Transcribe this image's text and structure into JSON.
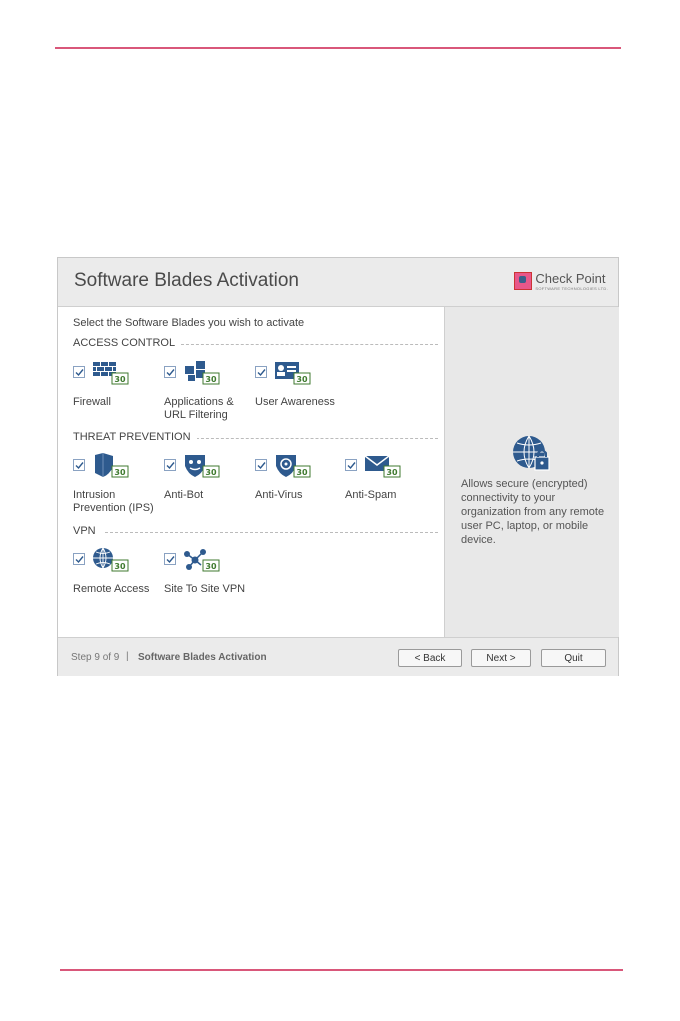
{
  "window": {
    "title": "Software Blades Activation",
    "logo": {
      "name": "Check Point",
      "tagline": "SOFTWARE TECHNOLOGIES LTD."
    }
  },
  "instruction": "Select the Software Blades you wish to activate",
  "sections": {
    "access_control": {
      "label": "ACCESS CONTROL",
      "blades": [
        {
          "label1": "Firewall",
          "label2": "",
          "checked": true,
          "badge": "30",
          "icon": "firewall-icon"
        },
        {
          "label1": "Applications &",
          "label2": "URL Filtering",
          "checked": true,
          "badge": "30",
          "icon": "applications-icon"
        },
        {
          "label1": "User Awareness",
          "label2": "",
          "checked": true,
          "badge": "30",
          "icon": "user-awareness-icon"
        }
      ]
    },
    "threat_prevention": {
      "label": "THREAT PREVENTION",
      "blades": [
        {
          "label1": "Intrusion",
          "label2": "Prevention (IPS)",
          "checked": true,
          "badge": "30",
          "icon": "ips-icon"
        },
        {
          "label1": "Anti-Bot",
          "label2": "",
          "checked": true,
          "badge": "30",
          "icon": "anti-bot-icon"
        },
        {
          "label1": "Anti-Virus",
          "label2": "",
          "checked": true,
          "badge": "30",
          "icon": "anti-virus-icon"
        },
        {
          "label1": "Anti-Spam",
          "label2": "",
          "checked": true,
          "badge": "30",
          "icon": "anti-spam-icon"
        }
      ]
    },
    "vpn": {
      "label": "VPN",
      "blades": [
        {
          "label1": "Remote Access",
          "label2": "",
          "checked": true,
          "badge": "30",
          "icon": "remote-access-icon"
        },
        {
          "label1": "Site To Site VPN",
          "label2": "",
          "checked": true,
          "badge": "30",
          "icon": "site-to-site-vpn-icon"
        }
      ]
    }
  },
  "description": {
    "icon": "remote-access-globe-lock-icon",
    "text": "Allows secure (encrypted) connectivity to your organization from any remote user PC, laptop, or mobile device."
  },
  "footer": {
    "step": "Step 9 of 9",
    "separator": "|",
    "step_name": "Software Blades Activation",
    "back_label": "< Back",
    "next_label": "Next >",
    "quit_label": "Quit"
  },
  "colors": {
    "accent_rule": "#d9577a",
    "icon_blue": "#2e5a8e",
    "badge_green": "#3f7a2f"
  }
}
